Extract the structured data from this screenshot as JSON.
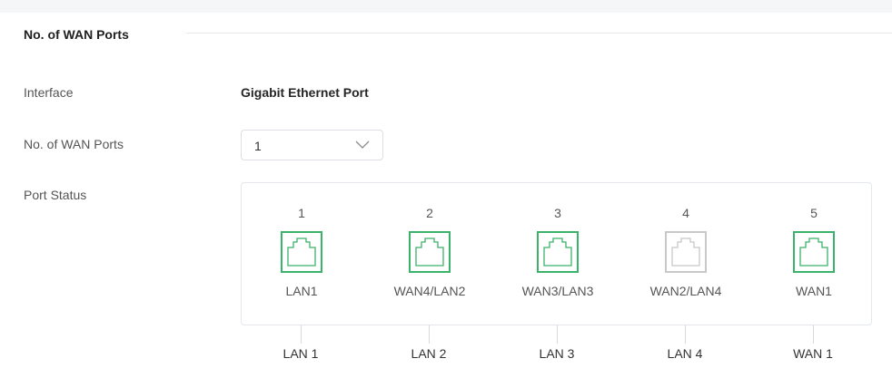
{
  "section": {
    "title": "No. of WAN Ports"
  },
  "interface": {
    "label": "Interface",
    "value": "Gigabit Ethernet Port"
  },
  "wan_ports": {
    "label": "No. of WAN Ports",
    "selected": "1"
  },
  "port_status": {
    "label": "Port Status",
    "ports": [
      {
        "number": "1",
        "name": "LAN1",
        "active": true
      },
      {
        "number": "2",
        "name": "WAN4/LAN2",
        "active": true
      },
      {
        "number": "3",
        "name": "WAN3/LAN3",
        "active": true
      },
      {
        "number": "4",
        "name": "WAN2/LAN4",
        "active": false
      },
      {
        "number": "5",
        "name": "WAN1",
        "active": true
      }
    ]
  },
  "bottom_labels": [
    "LAN 1",
    "LAN 2",
    "LAN 3",
    "LAN 4",
    "WAN 1"
  ],
  "colors": {
    "active": "#3bb26a",
    "inactive": "#c8c8c8"
  }
}
